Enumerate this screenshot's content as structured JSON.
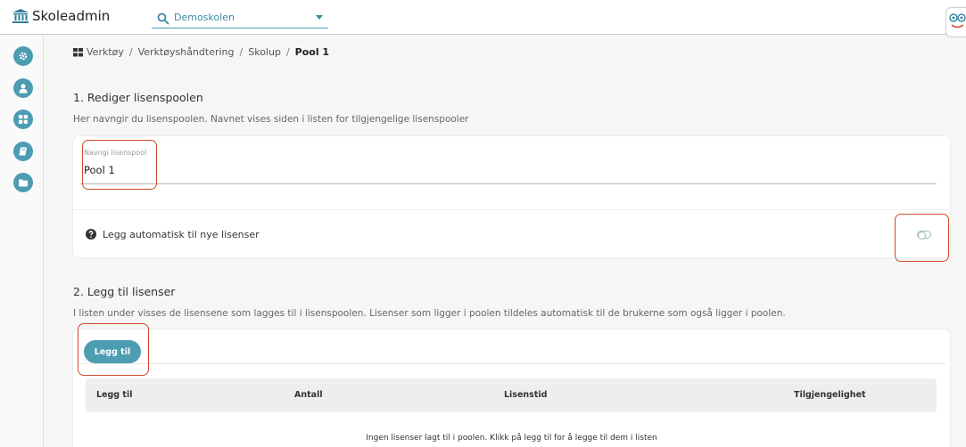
{
  "app": {
    "name": "Skoleadmin"
  },
  "school_selector": {
    "value": "Demoskolen"
  },
  "sidebar": {
    "items": [
      {
        "icon": "gear-icon"
      },
      {
        "icon": "user-icon"
      },
      {
        "icon": "grid-icon"
      },
      {
        "icon": "book-icon"
      },
      {
        "icon": "folder-icon"
      }
    ]
  },
  "breadcrumb": {
    "items": [
      "Verktøy",
      "Verktøyshåndtering",
      "Skolup"
    ],
    "current": "Pool 1",
    "separator": "/"
  },
  "section1": {
    "title": "1. Rediger lisenspoolen",
    "description": "Her navngir du lisenspoolen. Navnet vises siden i listen for tilgjengelige lisenspooler",
    "name_field": {
      "label": "Navngi lisenspool",
      "value": "Pool 1"
    },
    "auto_add": {
      "label": "Legg automatisk til nye lisenser",
      "enabled": false
    }
  },
  "section2": {
    "title": "2. Legg til lisenser",
    "description": "I listen under visses de lisensene som lagges til i lisenspoolen. Lisenser som ligger i poolen tildeles automatisk til de brukerne som også ligger i poolen.",
    "add_button": "Legg til",
    "table": {
      "columns": [
        "Legg til",
        "Antall",
        "Lisenstid",
        "Tilgjengelighet"
      ],
      "empty_message": "Ingen lisenser lagt til i poolen. Klikk på legg til for å legge til dem i listen"
    }
  },
  "colors": {
    "accent": "#4c9cb2",
    "highlight": "#d04a2a"
  }
}
